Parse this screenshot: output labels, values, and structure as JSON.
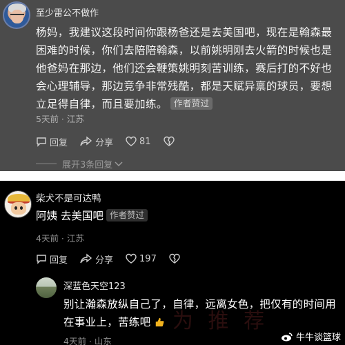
{
  "comments": [
    {
      "user": "至少雷公不做作",
      "text": "杨妈，我建议这段时间你跟杨爸还是去美国吧，现在是翰森最困难的时候，你们去陪陪翰森，以前姚明刚去火箭的时候也是他爸妈在那边，他们还会鞭策姚明刻苦训练，赛后打的不好也会心理辅导，那边竞争非常残酷，都是天赋异禀的球员，要想立足得自律，而且要加练。",
      "badge": "作者赞过",
      "meta": "5天前 · 江苏",
      "reply_label": "回复",
      "share_label": "分享",
      "like_count": "81",
      "expand_label": "展开3条回复"
    },
    {
      "user": "柴犬不是可达鸭",
      "text": "阿姨 去美国吧",
      "badge": "作者赞过",
      "meta": "4天前 · 江苏",
      "reply_label": "回复",
      "share_label": "分享",
      "like_count": "197"
    }
  ],
  "reply": {
    "user": "深蓝色天空123",
    "text": "别让瀚森放纵自己了，自律，远离女色，把仅有的时间用在事业上，苦练吧",
    "meta": "4天前 · 山东"
  },
  "watermark_text": "为 推 荐",
  "brand": "牛牛谈篮球"
}
